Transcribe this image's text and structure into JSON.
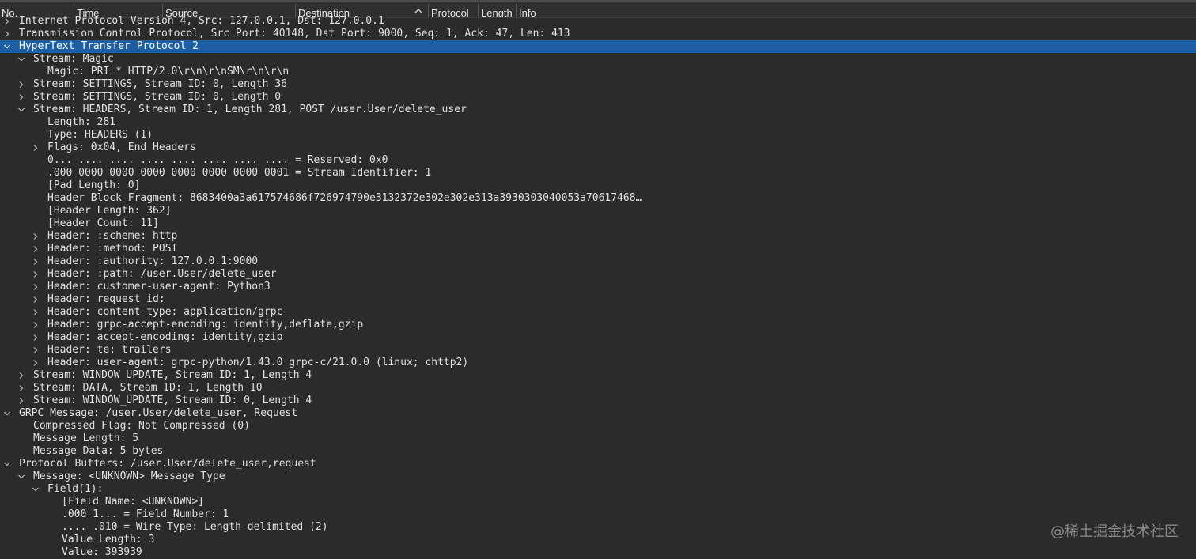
{
  "columns": [
    {
      "label": "No."
    },
    {
      "label": "Time"
    },
    {
      "label": "Source"
    },
    {
      "label": "Destination"
    },
    {
      "label": "Protocol"
    },
    {
      "label": "Length"
    },
    {
      "label": "Info"
    }
  ],
  "tree": [
    {
      "level": 0,
      "toggle": "collapsed",
      "text": "Internet Protocol Version 4, Src: 127.0.0.1, Dst: 127.0.0.1"
    },
    {
      "level": 0,
      "toggle": "collapsed",
      "text": "Transmission Control Protocol, Src Port: 40148, Dst Port: 9000, Seq: 1, Ack: 47, Len: 413"
    },
    {
      "level": 0,
      "toggle": "expanded",
      "selected": true,
      "text": "HyperText Transfer Protocol 2"
    },
    {
      "level": 1,
      "toggle": "expanded",
      "text": "Stream: Magic"
    },
    {
      "level": 2,
      "toggle": "none",
      "text": "Magic: PRI * HTTP/2.0\\r\\n\\r\\nSM\\r\\n\\r\\n"
    },
    {
      "level": 1,
      "toggle": "collapsed",
      "text": "Stream: SETTINGS, Stream ID: 0, Length 36"
    },
    {
      "level": 1,
      "toggle": "collapsed",
      "text": "Stream: SETTINGS, Stream ID: 0, Length 0"
    },
    {
      "level": 1,
      "toggle": "expanded",
      "text": "Stream: HEADERS, Stream ID: 1, Length 281, POST /user.User/delete_user"
    },
    {
      "level": 2,
      "toggle": "none",
      "text": "Length: 281"
    },
    {
      "level": 2,
      "toggle": "none",
      "text": "Type: HEADERS (1)"
    },
    {
      "level": 2,
      "toggle": "collapsed",
      "text": "Flags: 0x04, End Headers"
    },
    {
      "level": 2,
      "toggle": "none",
      "text": "0... .... .... .... .... .... .... .... = Reserved: 0x0"
    },
    {
      "level": 2,
      "toggle": "none",
      "text": ".000 0000 0000 0000 0000 0000 0000 0001 = Stream Identifier: 1"
    },
    {
      "level": 2,
      "toggle": "none",
      "text": "[Pad Length: 0]"
    },
    {
      "level": 2,
      "toggle": "none",
      "text": "Header Block Fragment: 8683400a3a617574686f726974790e3132372e302e302e313a3930303040053a70617468…"
    },
    {
      "level": 2,
      "toggle": "none",
      "text": "[Header Length: 362]"
    },
    {
      "level": 2,
      "toggle": "none",
      "text": "[Header Count: 11]"
    },
    {
      "level": 2,
      "toggle": "collapsed",
      "text": "Header: :scheme: http"
    },
    {
      "level": 2,
      "toggle": "collapsed",
      "text": "Header: :method: POST"
    },
    {
      "level": 2,
      "toggle": "collapsed",
      "text": "Header: :authority: 127.0.0.1:9000"
    },
    {
      "level": 2,
      "toggle": "collapsed",
      "text": "Header: :path: /user.User/delete_user"
    },
    {
      "level": 2,
      "toggle": "collapsed",
      "text": "Header: customer-user-agent: Python3"
    },
    {
      "level": 2,
      "toggle": "collapsed",
      "text": "Header: request_id:"
    },
    {
      "level": 2,
      "toggle": "collapsed",
      "text": "Header: content-type: application/grpc"
    },
    {
      "level": 2,
      "toggle": "collapsed",
      "text": "Header: grpc-accept-encoding: identity,deflate,gzip"
    },
    {
      "level": 2,
      "toggle": "collapsed",
      "text": "Header: accept-encoding: identity,gzip"
    },
    {
      "level": 2,
      "toggle": "collapsed",
      "text": "Header: te: trailers"
    },
    {
      "level": 2,
      "toggle": "collapsed",
      "text": "Header: user-agent: grpc-python/1.43.0 grpc-c/21.0.0 (linux; chttp2)"
    },
    {
      "level": 1,
      "toggle": "collapsed",
      "text": "Stream: WINDOW_UPDATE, Stream ID: 1, Length 4"
    },
    {
      "level": 1,
      "toggle": "collapsed",
      "text": "Stream: DATA, Stream ID: 1, Length 10"
    },
    {
      "level": 1,
      "toggle": "collapsed",
      "text": "Stream: WINDOW_UPDATE, Stream ID: 0, Length 4"
    },
    {
      "level": 0,
      "toggle": "expanded",
      "text": "GRPC Message: /user.User/delete_user, Request"
    },
    {
      "level": 1,
      "toggle": "none",
      "text": "Compressed Flag: Not Compressed (0)"
    },
    {
      "level": 1,
      "toggle": "none",
      "text": "Message Length: 5"
    },
    {
      "level": 1,
      "toggle": "none",
      "text": "Message Data: 5 bytes"
    },
    {
      "level": 0,
      "toggle": "expanded",
      "text": "Protocol Buffers: /user.User/delete_user,request"
    },
    {
      "level": 1,
      "toggle": "expanded",
      "text": "Message: <UNKNOWN> Message Type"
    },
    {
      "level": 2,
      "toggle": "expanded",
      "text": "Field(1):"
    },
    {
      "level": 3,
      "toggle": "none",
      "text": "[Field Name: <UNKNOWN>]"
    },
    {
      "level": 3,
      "toggle": "none",
      "text": ".000 1... = Field Number: 1"
    },
    {
      "level": 3,
      "toggle": "none",
      "text": ".... .010 = Wire Type: Length-delimited (2)"
    },
    {
      "level": 3,
      "toggle": "none",
      "text": "Value Length: 3"
    },
    {
      "level": 3,
      "toggle": "none",
      "text": "Value: 393939"
    }
  ],
  "watermark": "@稀土掘金技术社区",
  "icons": {
    "collapsed": "chevron-right-icon",
    "expanded": "chevron-down-icon",
    "sort": "sort-ascending-icon"
  },
  "colors": {
    "background": "#2b2b2b",
    "selected_row": "#1e5fa3",
    "text": "#e0e0e0"
  }
}
